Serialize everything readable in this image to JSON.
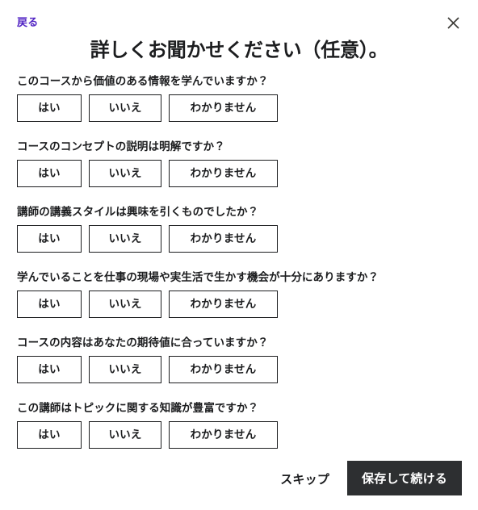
{
  "header": {
    "back_label": "戻る",
    "close_icon": "close-icon",
    "title": "詳しくお聞かせください（任意）。",
    "back_color": "#5022c3"
  },
  "questions": [
    {
      "text": "このコースから価値のある情報を学んでいますか？",
      "options": [
        "はい",
        "いいえ",
        "わかりません"
      ]
    },
    {
      "text": "コースのコンセプトの説明は明解ですか？",
      "options": [
        "はい",
        "いいえ",
        "わかりません"
      ]
    },
    {
      "text": "講師の講義スタイルは興味を引くものでしたか？",
      "options": [
        "はい",
        "いいえ",
        "わかりません"
      ]
    },
    {
      "text": "学んでいることを仕事の現場や実生活で生かす機会が十分にありますか？",
      "options": [
        "はい",
        "いいえ",
        "わかりません"
      ]
    },
    {
      "text": "コースの内容はあなたの期待値に合っていますか？",
      "options": [
        "はい",
        "いいえ",
        "わかりません"
      ]
    },
    {
      "text": "この講師はトピックに関する知識が豊富ですか？",
      "options": [
        "はい",
        "いいえ",
        "わかりません"
      ]
    }
  ],
  "footer": {
    "skip_label": "スキップ",
    "save_label": "保存して続ける",
    "save_bg": "#2d2f31"
  }
}
